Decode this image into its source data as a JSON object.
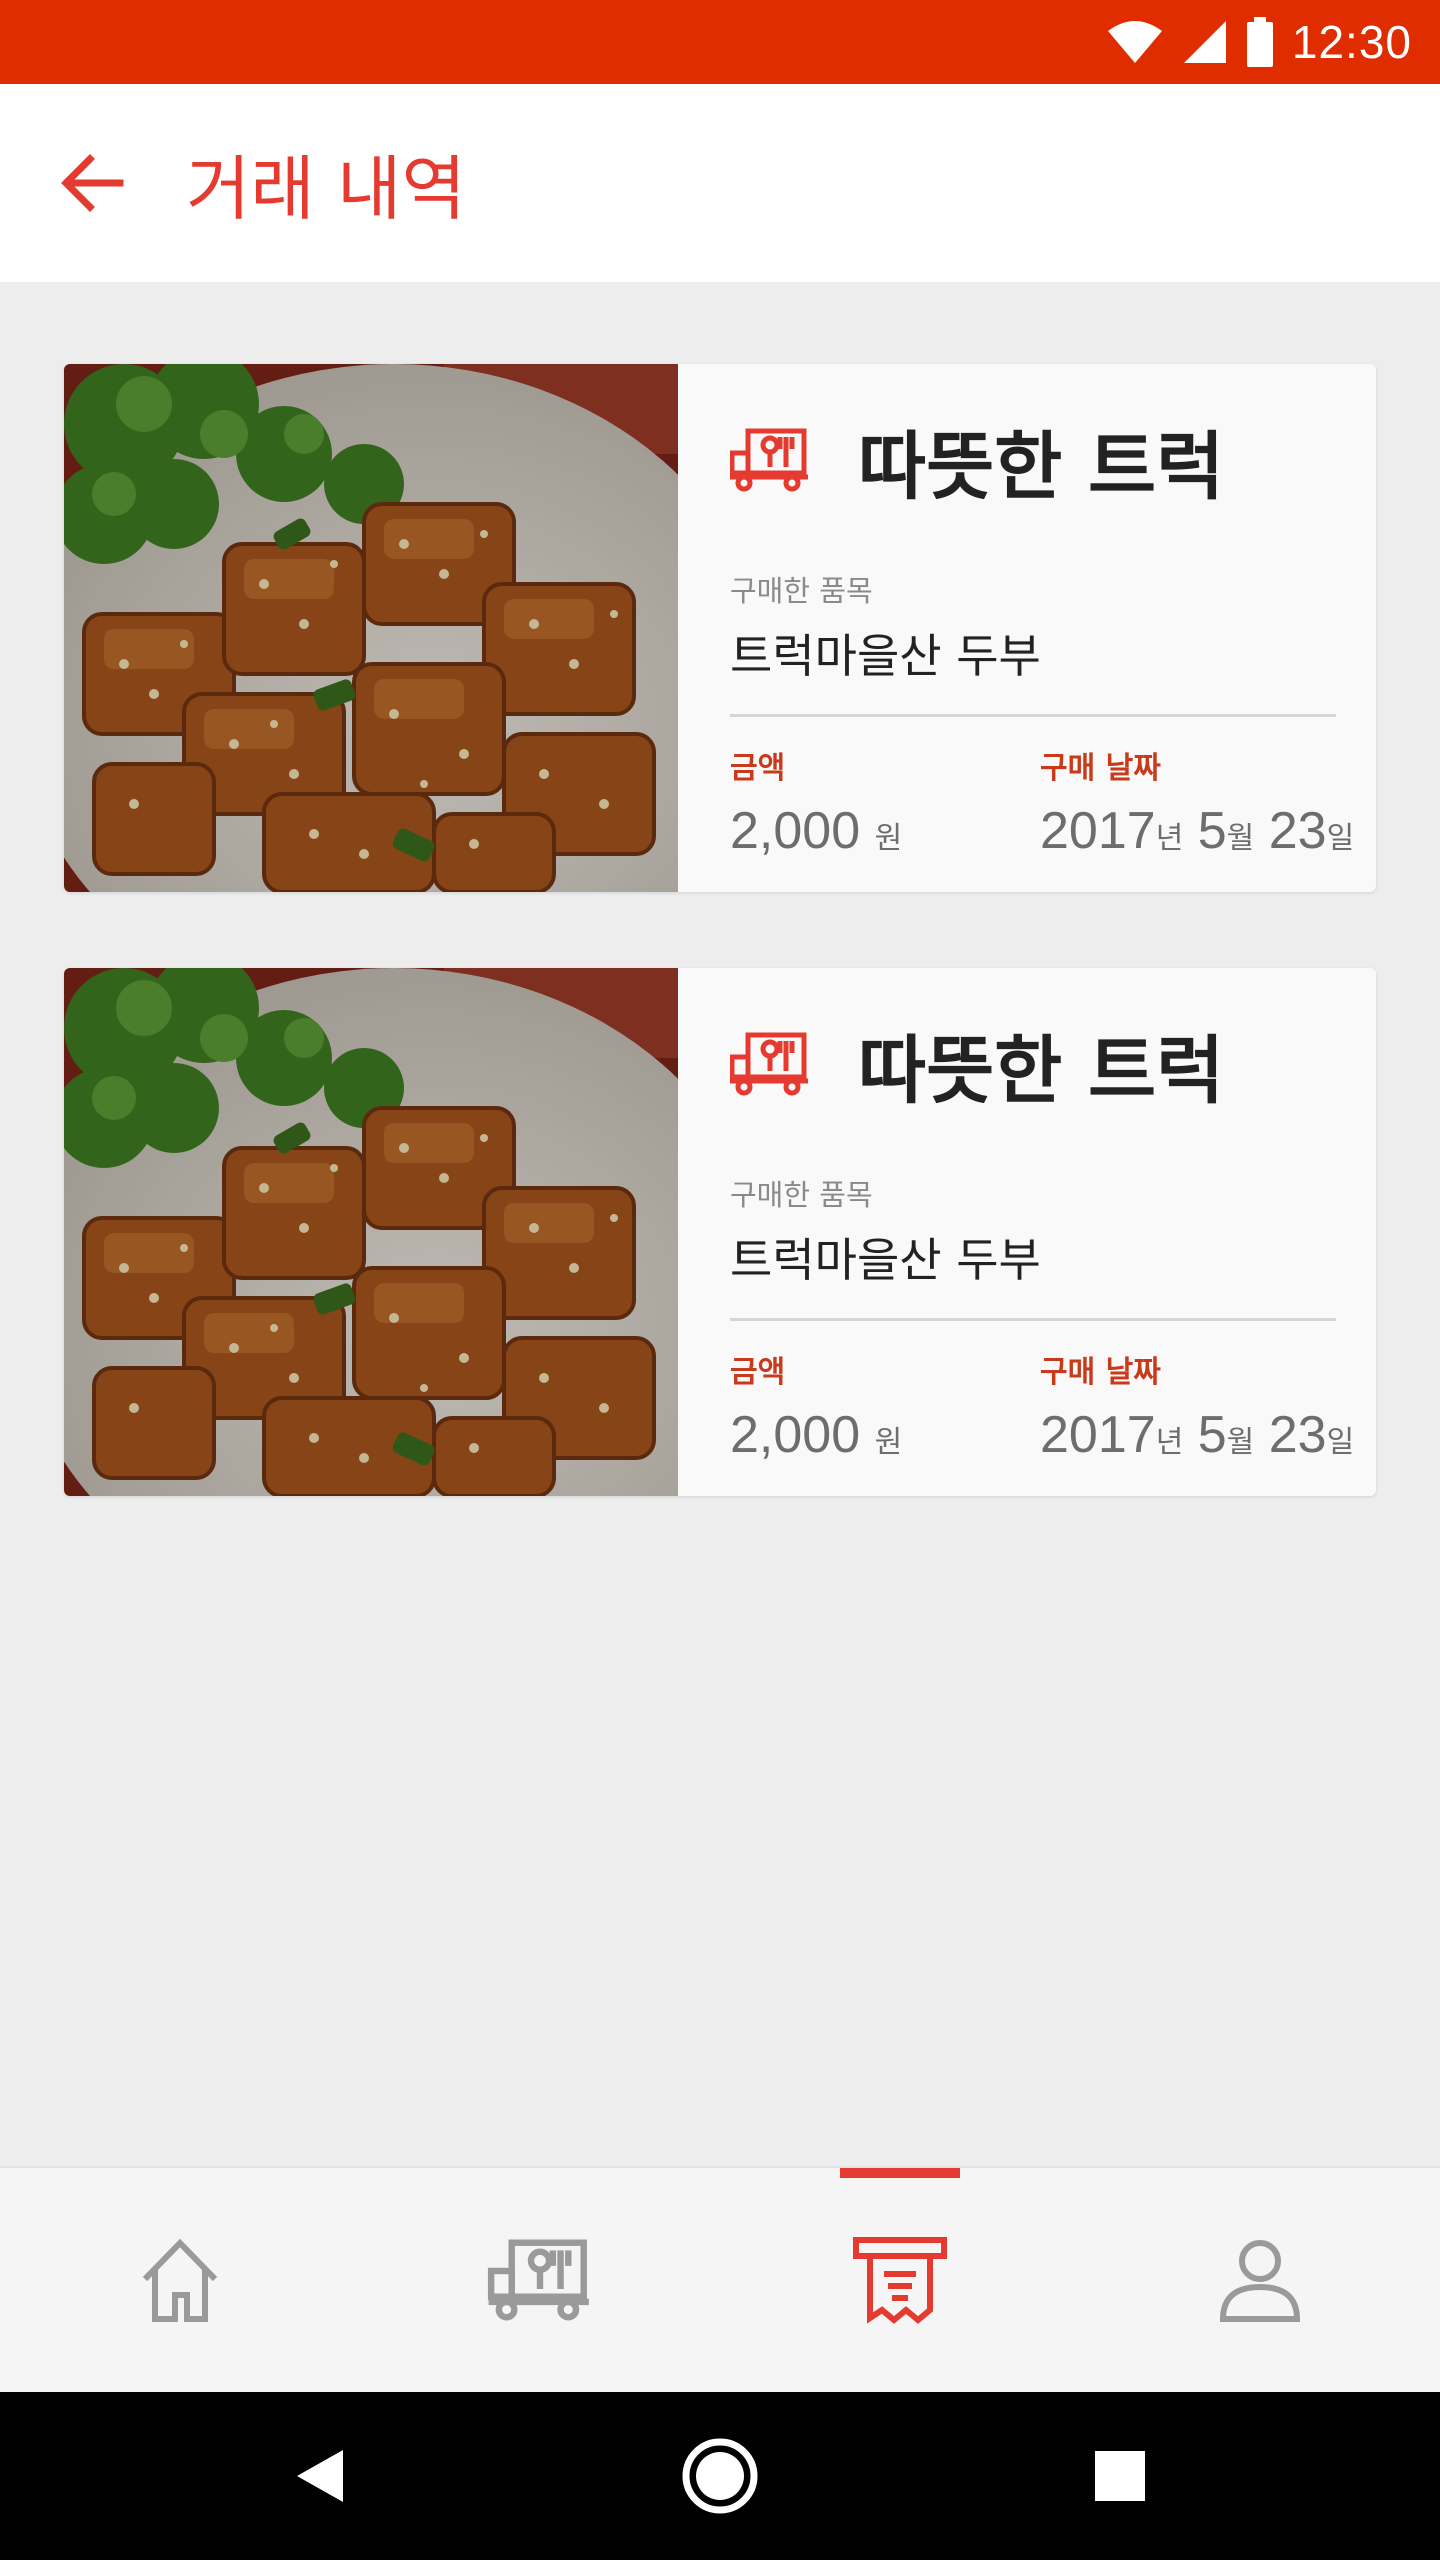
{
  "status_bar": {
    "time": "12:30"
  },
  "app_bar": {
    "title": "거래 내역",
    "back_icon": "arrow-left-icon"
  },
  "colors": {
    "accent": "#e53a2f",
    "status_bar": "#e02d00",
    "label_red": "#c93a1a"
  },
  "transactions": [
    {
      "vendor": "따뜻한 트럭",
      "vendor_icon": "food-truck-icon",
      "item_label": "구매한 품목",
      "item": "트럭마을산 두부",
      "amount_label": "금액",
      "amount": "2,000",
      "amount_unit": "원",
      "date_label": "구매 날짜",
      "date_year": "2017",
      "date_year_unit": "년",
      "date_month": "5",
      "date_month_unit": "월",
      "date_day": "23",
      "date_day_unit": "일",
      "image": "tofu-dish-photo"
    },
    {
      "vendor": "따뜻한 트럭",
      "vendor_icon": "food-truck-icon",
      "item_label": "구매한 품목",
      "item": "트럭마을산 두부",
      "amount_label": "금액",
      "amount": "2,000",
      "amount_unit": "원",
      "date_label": "구매 날짜",
      "date_year": "2017",
      "date_year_unit": "년",
      "date_month": "5",
      "date_month_unit": "월",
      "date_day": "23",
      "date_day_unit": "일",
      "image": "tofu-dish-photo"
    }
  ],
  "bottom_nav": [
    {
      "icon": "home-icon",
      "active": false
    },
    {
      "icon": "food-truck-icon",
      "active": false
    },
    {
      "icon": "receipt-icon",
      "active": true
    },
    {
      "icon": "person-icon",
      "active": false
    }
  ]
}
